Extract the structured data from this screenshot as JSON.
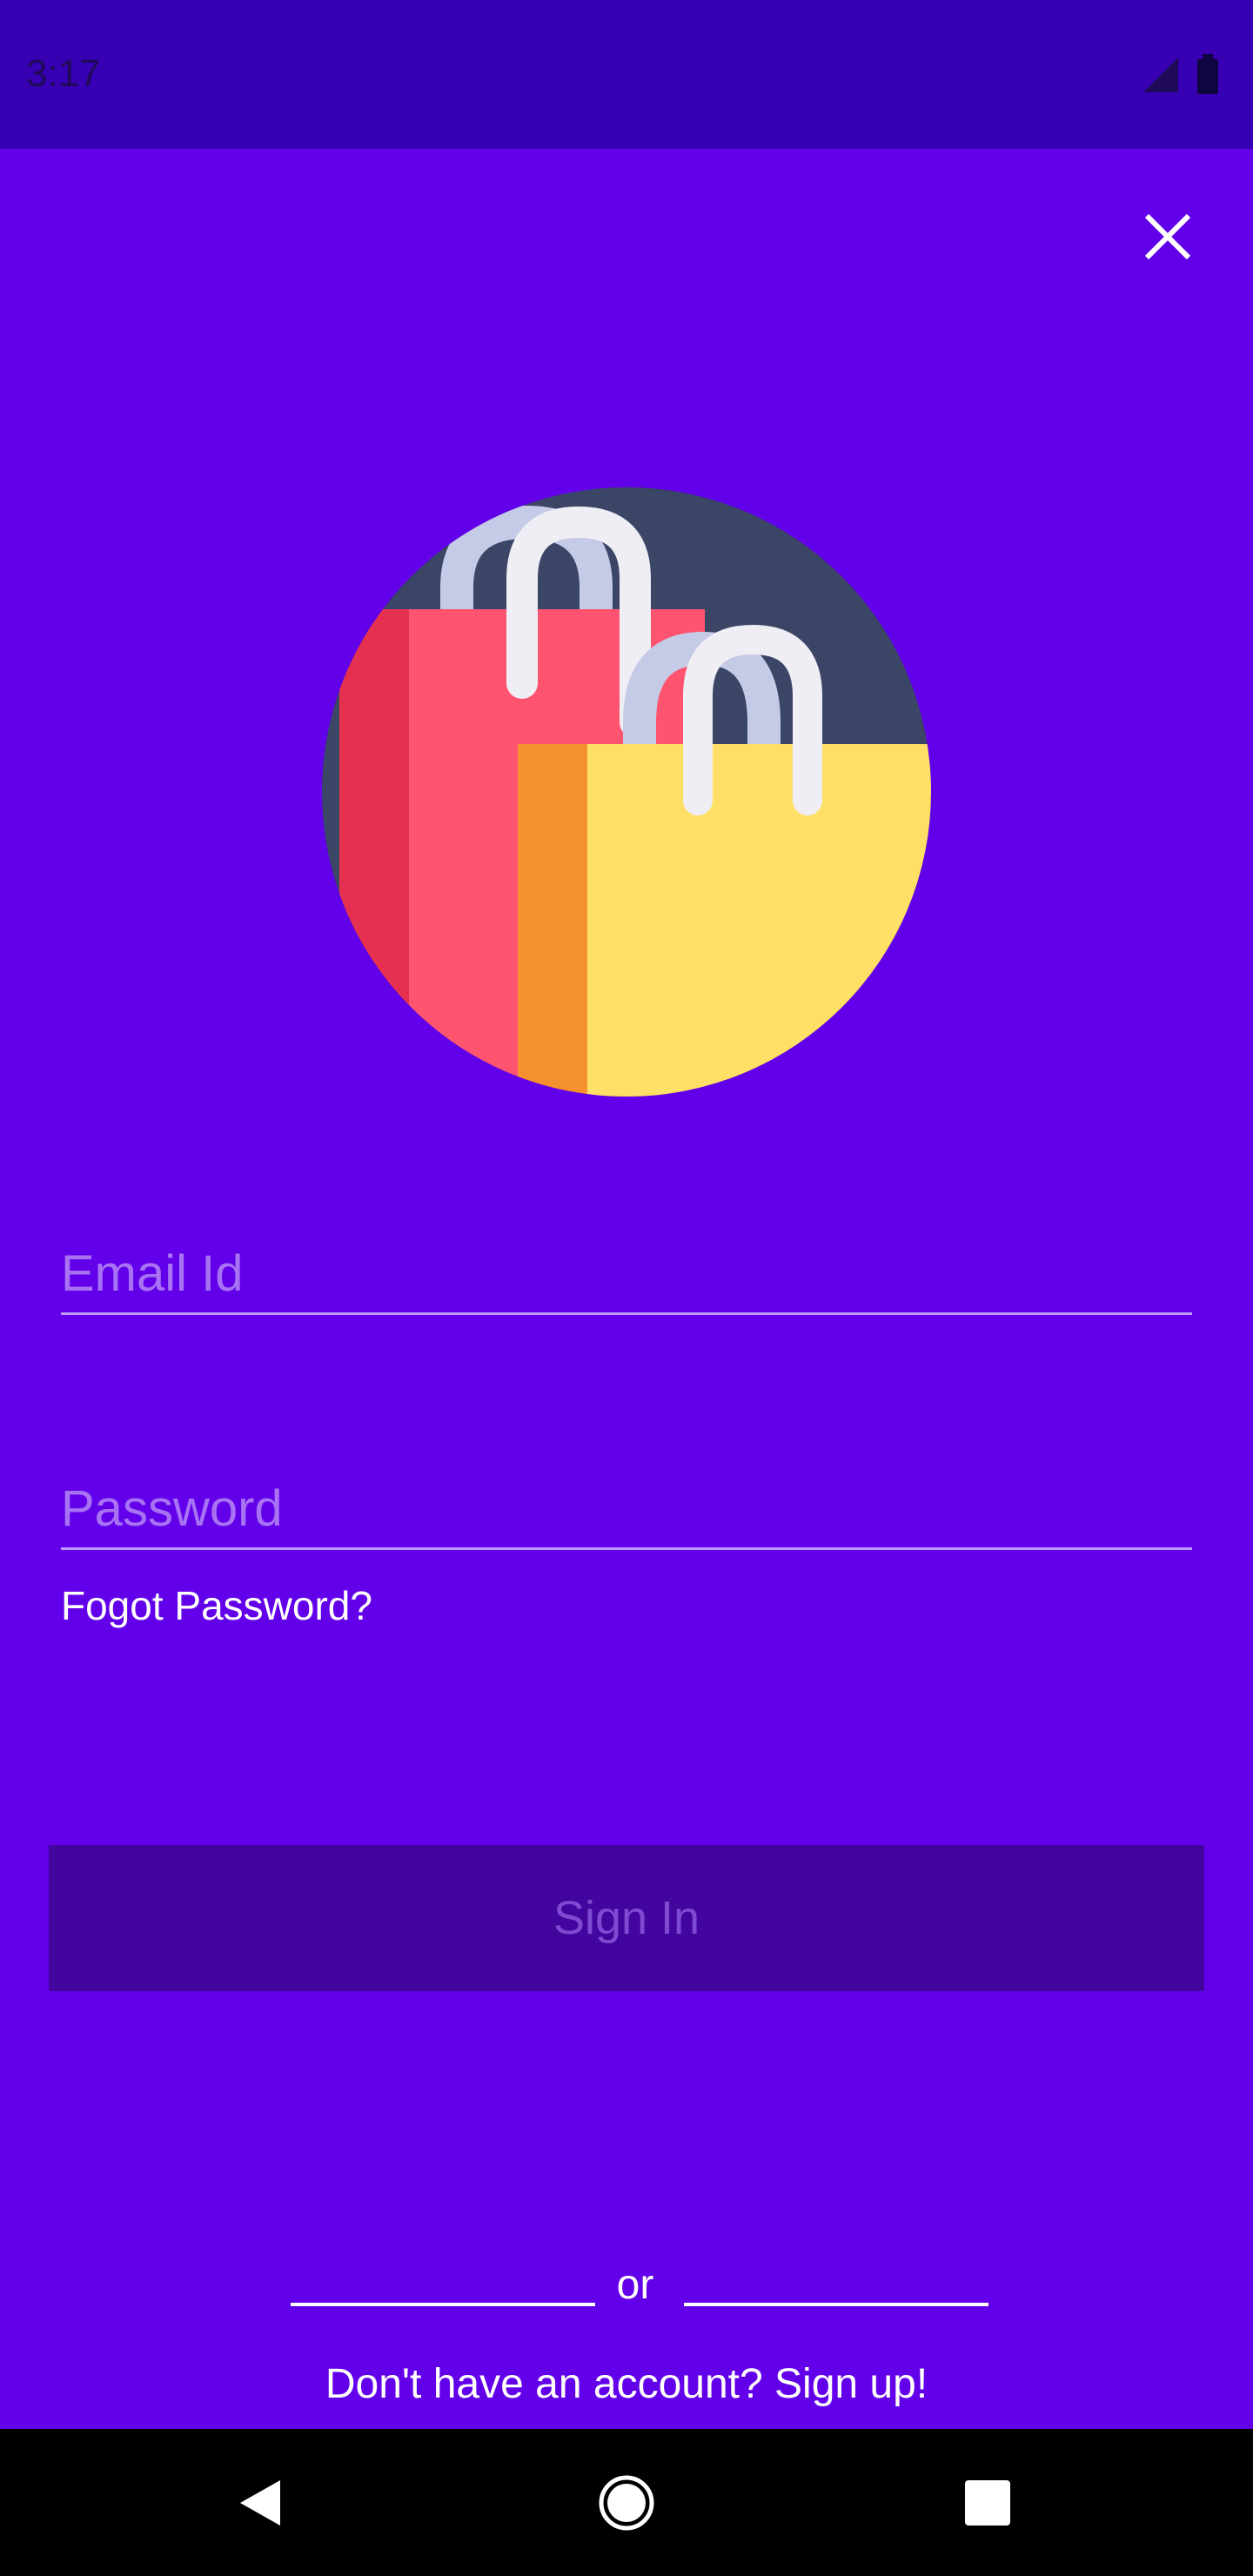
{
  "status_bar": {
    "time": "3:17"
  },
  "login": {
    "email_placeholder": "Email Id",
    "password_placeholder": "Password",
    "forgot_password": "Fogot Password?",
    "sign_in": "Sign In",
    "divider_text": "or",
    "signup_prompt": "Don't have an account? Sign up!"
  },
  "icons": {
    "close": "close-icon",
    "hero": "shopping-bags-illustration",
    "back": "back-icon",
    "home": "home-icon",
    "recents": "recents-icon"
  },
  "colors": {
    "background": "#6200ea",
    "status_bar": "#3700b3",
    "button": "#42069f",
    "button_text": "#7e4ad2"
  }
}
